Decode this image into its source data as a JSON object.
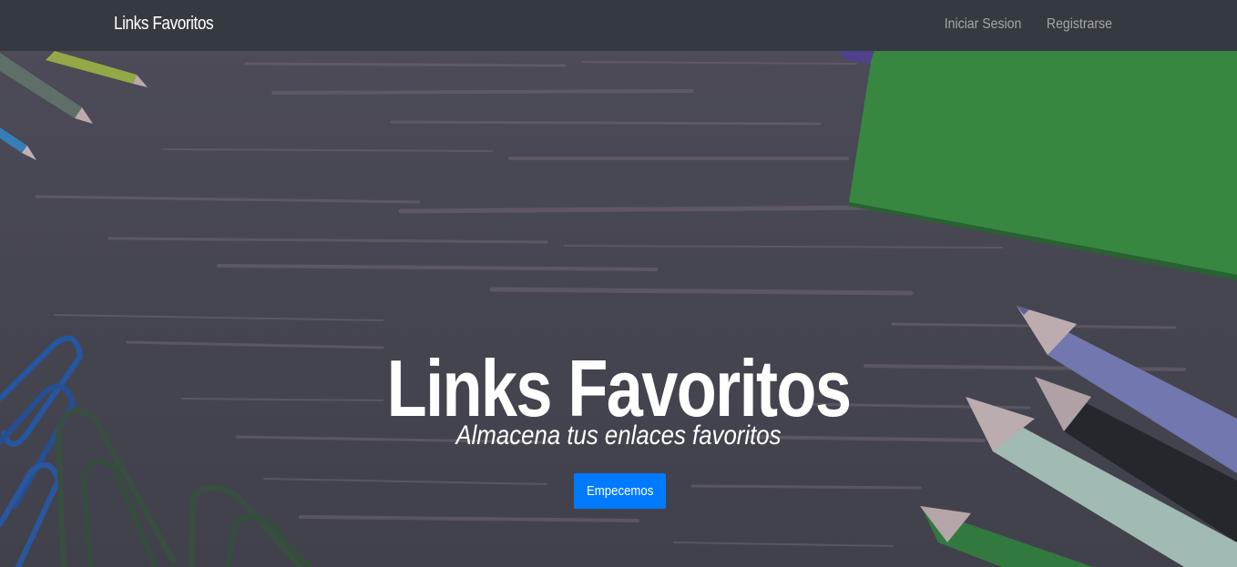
{
  "navbar": {
    "brand": "Links Favoritos",
    "links": [
      {
        "label": "Iniciar Sesion"
      },
      {
        "label": "Registrarse"
      }
    ]
  },
  "hero": {
    "title": "Links Favoritos",
    "subtitle": "Almacena tus enlaces favoritos",
    "cta_label": "Empecemos"
  },
  "colors": {
    "navbar_bg": "#343a40",
    "button_bg": "#007bff",
    "hero_bg": "#4f4f5c"
  }
}
